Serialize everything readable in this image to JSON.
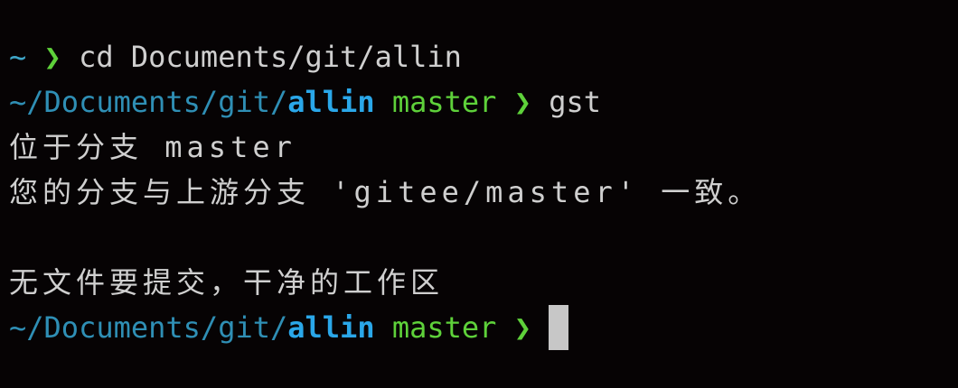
{
  "terminal": {
    "line1": {
      "tilde": "~",
      "arrow": "❯",
      "command": "cd Documents/git/allin"
    },
    "line2": {
      "path": "~/Documents/git/",
      "dir": "allin",
      "branch": "master",
      "arrow": "❯",
      "command": "gst"
    },
    "output": {
      "line1": "位于分支 master",
      "line2": "您的分支与上游分支 'gitee/master' 一致。",
      "line3": "",
      "line4": "无文件要提交，干净的工作区"
    },
    "prompt": {
      "path": "~/Documents/git/",
      "dir": "allin",
      "branch": "master",
      "arrow": "❯"
    }
  }
}
